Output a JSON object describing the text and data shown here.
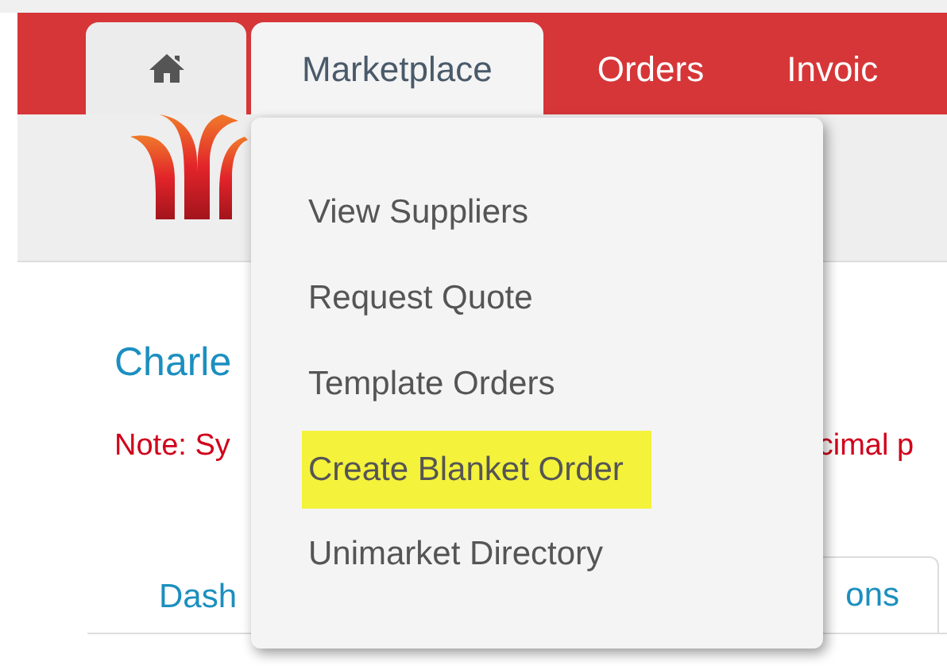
{
  "nav_tabs": [
    {
      "kind": "home",
      "selected": false
    },
    {
      "kind": "text",
      "label": "Marketplace",
      "selected": true
    },
    {
      "kind": "text",
      "label": "Orders",
      "selected": false
    },
    {
      "kind": "text",
      "label": "Invoic",
      "selected": false
    }
  ],
  "page": {
    "heading": "Charle",
    "note_left": "Note: Sy",
    "note_right": "cimal p"
  },
  "page_tabs": [
    {
      "label": "Dash",
      "selected": false
    },
    {
      "label": "ons",
      "selected": true
    }
  ],
  "dropdown": {
    "items": [
      {
        "label": "View Suppliers",
        "highlighted": false
      },
      {
        "label": "Request Quote",
        "highlighted": false
      },
      {
        "label": "Template Orders",
        "highlighted": false
      },
      {
        "label": "Create Blanket Order",
        "highlighted": true
      },
      {
        "label": "Unimarket Directory",
        "highlighted": false
      }
    ]
  }
}
